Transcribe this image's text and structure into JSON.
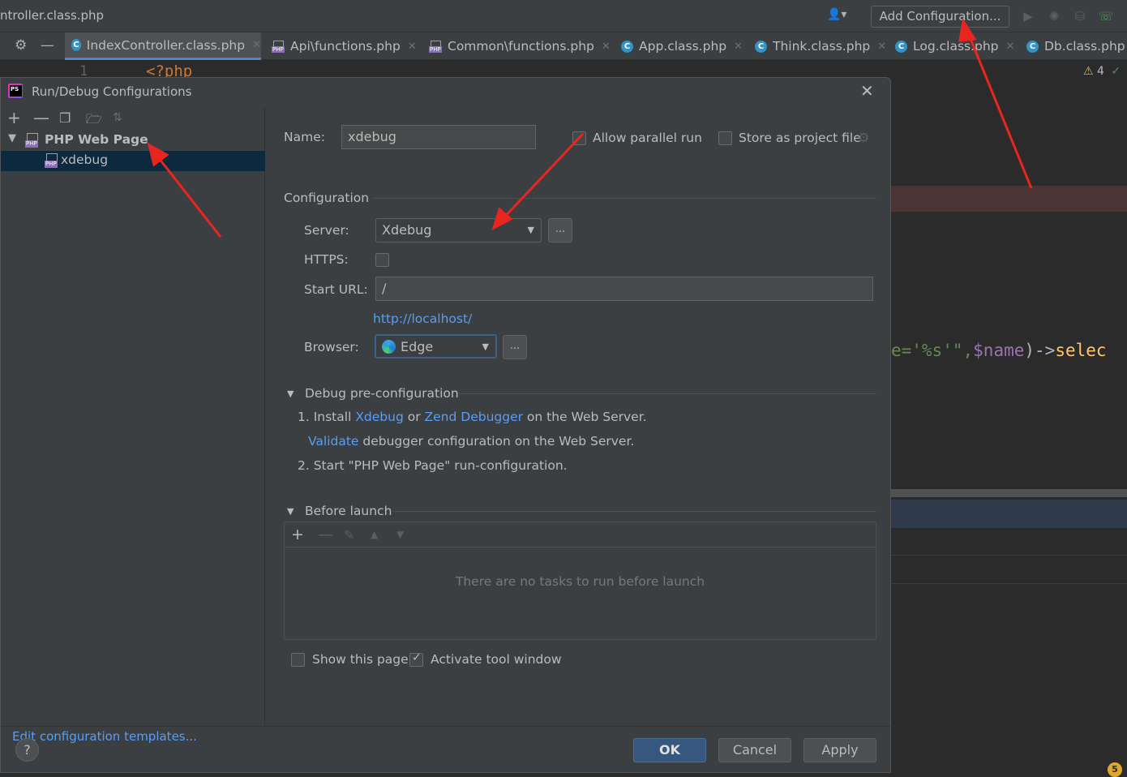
{
  "ide": {
    "file_title": "ntroller.class.php",
    "add_configuration_label": "Add Configuration...",
    "tabs": [
      {
        "label": "IndexController.class.php",
        "type": "class",
        "active": true
      },
      {
        "label": "Api\\functions.php",
        "type": "php",
        "active": false
      },
      {
        "label": "Common\\functions.php",
        "type": "php",
        "active": false
      },
      {
        "label": "App.class.php",
        "type": "class",
        "active": false
      },
      {
        "label": "Think.class.php",
        "type": "class",
        "active": false
      },
      {
        "label": "Log.class.php",
        "type": "class",
        "active": false
      },
      {
        "label": "Db.class.php",
        "type": "class",
        "active": false
      }
    ],
    "line_number": "1",
    "php_open_tag": "<?php",
    "warning_count": "4",
    "code_fragment": {
      "str": "e='%s'\",",
      "var": "$name",
      "op": ")->",
      "fn": "selec"
    },
    "notification_count": "5"
  },
  "dialog": {
    "title": "Run/Debug Configurations",
    "tree": {
      "group_label": "PHP Web Page",
      "item_label": "xdebug"
    },
    "edit_templates_link": "Edit configuration templates...",
    "name_label": "Name:",
    "name_value": "xdebug",
    "allow_parallel_run_label": "Allow parallel run",
    "allow_parallel_run_checked": false,
    "store_as_project_file_label": "Store as project file",
    "store_as_project_file_checked": false,
    "configuration_section": "Configuration",
    "server_label": "Server:",
    "server_value": "Xdebug",
    "https_label": "HTTPS:",
    "https_checked": false,
    "start_url_label": "Start URL:",
    "start_url_value": "/",
    "resolved_url": "http://localhost/",
    "browser_label": "Browser:",
    "browser_value": "Edge",
    "ellipsis_label": "...",
    "debug_preconfig_section": "Debug pre-configuration",
    "step1_prefix": "1. Install ",
    "step1_link1": "Xdebug",
    "step1_or": " or ",
    "step1_link2": "Zend Debugger",
    "step1_suffix": " on the Web Server.",
    "validate_link": "Validate",
    "validate_suffix": " debugger configuration on the Web Server.",
    "step2": "2. Start \"PHP Web Page\" run-configuration.",
    "before_launch_section": "Before launch",
    "before_launch_empty": "There are no tasks to run before launch",
    "show_this_page_label": "Show this page",
    "show_this_page_checked": false,
    "activate_tool_window_label": "Activate tool window",
    "activate_tool_window_checked": true,
    "help_label": "?",
    "ok_label": "OK",
    "cancel_label": "Cancel",
    "apply_label": "Apply"
  },
  "colors": {
    "accent_link": "#589df6",
    "primary_button": "#365880",
    "selection": "#0d293e",
    "annotation_arrow": "#e8251f"
  }
}
